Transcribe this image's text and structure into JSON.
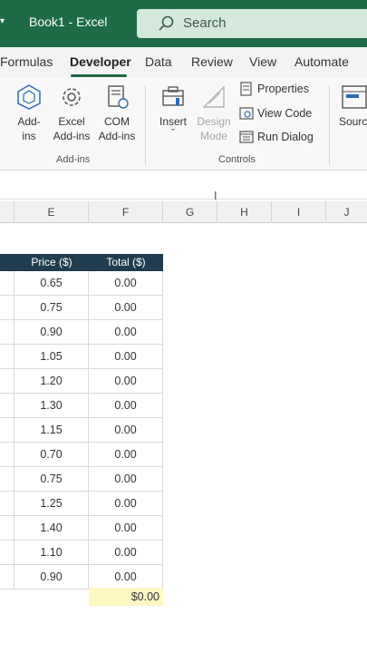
{
  "titlebar": {
    "title": "Book1  -  Excel",
    "search_placeholder": "Search"
  },
  "tabs": [
    {
      "label": "Formulas"
    },
    {
      "label": "Developer",
      "active": true
    },
    {
      "label": "Data"
    },
    {
      "label": "Review"
    },
    {
      "label": "View"
    },
    {
      "label": "Automate"
    }
  ],
  "ribbon": {
    "addins": {
      "group_label": "Add-ins",
      "addins_btn": "Add-\nins",
      "excel_addins_btn": "Excel\nAdd-ins",
      "com_addins_btn": "COM\nAdd-ins"
    },
    "controls": {
      "group_label": "Controls",
      "insert_btn": "Insert",
      "insert_chevron": "ˇ",
      "design_mode_btn": "Design\nMode",
      "properties": "Properties",
      "view_code": "View Code",
      "run_dialog": "Run Dialog"
    },
    "source_btn": "Sourc"
  },
  "columns": [
    "E",
    "F",
    "G",
    "H",
    "I",
    "J"
  ],
  "table": {
    "headers": [
      "Price ($)",
      "Total ($)"
    ],
    "rows": [
      {
        "price": "0.65",
        "total": "0.00"
      },
      {
        "price": "0.75",
        "total": "0.00"
      },
      {
        "price": "0.90",
        "total": "0.00"
      },
      {
        "price": "1.05",
        "total": "0.00"
      },
      {
        "price": "1.20",
        "total": "0.00"
      },
      {
        "price": "1.30",
        "total": "0.00"
      },
      {
        "price": "1.15",
        "total": "0.00"
      },
      {
        "price": "0.70",
        "total": "0.00"
      },
      {
        "price": "0.75",
        "total": "0.00"
      },
      {
        "price": "1.25",
        "total": "0.00"
      },
      {
        "price": "1.40",
        "total": "0.00"
      },
      {
        "price": "1.10",
        "total": "0.00"
      },
      {
        "price": "0.90",
        "total": "0.00"
      }
    ],
    "grand_total": "$0.00"
  },
  "colors": {
    "title_bar": "#1e6b46",
    "header_fill": "#1f3d4f",
    "total_fill": "#fdf7c4"
  }
}
